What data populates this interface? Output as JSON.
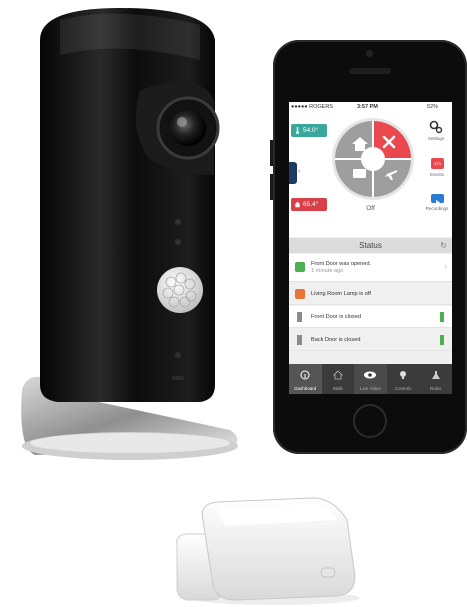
{
  "app": {
    "carrier": "●●●●● ROGERS",
    "time": "3:57 PM",
    "battery": "52%",
    "temp_indoor": "54.0°",
    "temp_outdoor": "65.4°",
    "mode_state": "Off",
    "right_menu": [
      "Settings",
      "Events",
      "Recordings"
    ],
    "events_badge": "373",
    "status_title": "Status",
    "status_rows": [
      {
        "text": "Front Door was opened.",
        "sub": "1 minute ago"
      },
      {
        "text": "Living Room Lamp is off"
      },
      {
        "text": "Front Door is closed"
      },
      {
        "text": "Back Door is closed"
      }
    ],
    "tabs": [
      "Dashboard",
      "Walk",
      "Live Video",
      "Controls",
      "Rules"
    ]
  },
  "colors": {
    "accent_red": "#e8484e",
    "teal": "#3aa79c",
    "status_green": "#4caf50",
    "orange": "#e9743a",
    "camera_black": "#0b0b0b"
  },
  "icons": [
    "camera-lens-icon",
    "motion-sensor-icon",
    "gear-icon",
    "alert-icon",
    "video-icon",
    "home-icon",
    "lock-icon",
    "briefcase-icon",
    "plane-icon",
    "close-icon"
  ]
}
